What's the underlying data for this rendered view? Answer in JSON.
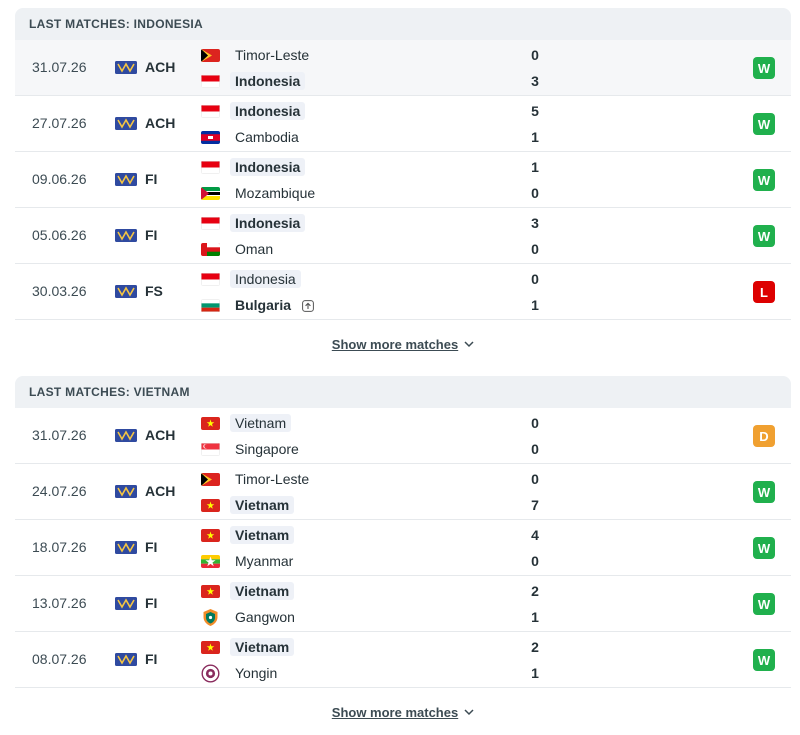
{
  "sections": [
    {
      "title": "LAST MATCHES: INDONESIA",
      "show_more": "Show more matches",
      "matches": [
        {
          "date": "31.07.26",
          "comp": "ACH",
          "home": "Timor-Leste",
          "away": "Indonesia",
          "home_flag": "timor-leste",
          "away_flag": "indonesia",
          "home_score": "0",
          "away_score": "3",
          "result": "W",
          "focus": "away",
          "bold": "away",
          "shaded": true
        },
        {
          "date": "27.07.26",
          "comp": "ACH",
          "home": "Indonesia",
          "away": "Cambodia",
          "home_flag": "indonesia",
          "away_flag": "cambodia",
          "home_score": "5",
          "away_score": "1",
          "result": "W",
          "focus": "home",
          "bold": "home",
          "shaded": false
        },
        {
          "date": "09.06.26",
          "comp": "FI",
          "home": "Indonesia",
          "away": "Mozambique",
          "home_flag": "indonesia",
          "away_flag": "mozambique",
          "home_score": "1",
          "away_score": "0",
          "result": "W",
          "focus": "home",
          "bold": "home",
          "shaded": false
        },
        {
          "date": "05.06.26",
          "comp": "FI",
          "home": "Indonesia",
          "away": "Oman",
          "home_flag": "indonesia",
          "away_flag": "oman",
          "home_score": "3",
          "away_score": "0",
          "result": "W",
          "focus": "home",
          "bold": "home",
          "shaded": false
        },
        {
          "date": "30.03.26",
          "comp": "FS",
          "home": "Indonesia",
          "away": "Bulgaria",
          "home_flag": "indonesia",
          "away_flag": "bulgaria",
          "home_score": "0",
          "away_score": "1",
          "result": "L",
          "focus": "home",
          "bold": "away",
          "shaded": false,
          "away_icon": "arrow-up-box-icon"
        }
      ]
    },
    {
      "title": "LAST MATCHES: VIETNAM",
      "show_more": "Show more matches",
      "matches": [
        {
          "date": "31.07.26",
          "comp": "ACH",
          "home": "Vietnam",
          "away": "Singapore",
          "home_flag": "vietnam",
          "away_flag": "singapore",
          "home_score": "0",
          "away_score": "0",
          "result": "D",
          "focus": "home",
          "bold": "",
          "shaded": false
        },
        {
          "date": "24.07.26",
          "comp": "ACH",
          "home": "Timor-Leste",
          "away": "Vietnam",
          "home_flag": "timor-leste",
          "away_flag": "vietnam",
          "home_score": "0",
          "away_score": "7",
          "result": "W",
          "focus": "away",
          "bold": "away",
          "shaded": false
        },
        {
          "date": "18.07.26",
          "comp": "FI",
          "home": "Vietnam",
          "away": "Myanmar",
          "home_flag": "vietnam",
          "away_flag": "myanmar",
          "home_score": "4",
          "away_score": "0",
          "result": "W",
          "focus": "home",
          "bold": "home",
          "shaded": false
        },
        {
          "date": "13.07.26",
          "comp": "FI",
          "home": "Vietnam",
          "away": "Gangwon",
          "home_flag": "vietnam",
          "away_flag": "gangwon-crest",
          "home_score": "2",
          "away_score": "1",
          "result": "W",
          "focus": "home",
          "bold": "home",
          "shaded": false
        },
        {
          "date": "08.07.26",
          "comp": "FI",
          "home": "Vietnam",
          "away": "Yongin",
          "home_flag": "vietnam",
          "away_flag": "yongin-crest",
          "home_score": "2",
          "away_score": "1",
          "result": "W",
          "focus": "home",
          "bold": "home",
          "shaded": false
        }
      ]
    }
  ],
  "colors": {
    "win": "#20b04d",
    "loss": "#dd0000",
    "draw": "#f0a030"
  }
}
